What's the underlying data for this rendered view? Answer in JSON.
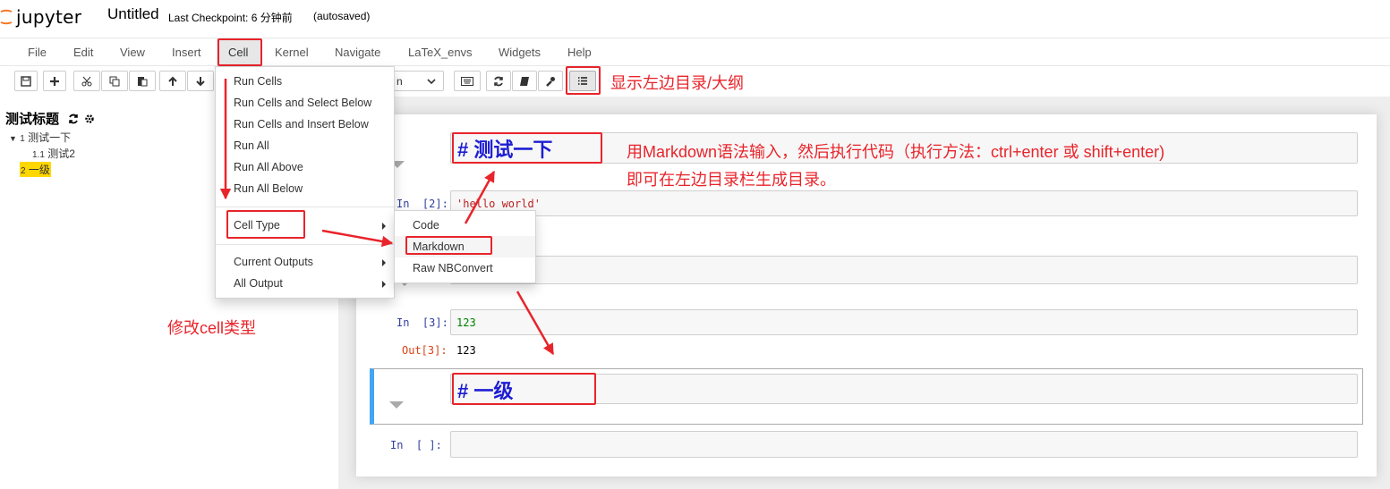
{
  "header": {
    "logo_text": "jupyter",
    "notebook_title": "Untitled",
    "checkpoint": "Last Checkpoint: 6 分钟前",
    "autosaved": "(autosaved)"
  },
  "menubar": [
    "File",
    "Edit",
    "View",
    "Insert",
    "Cell",
    "Kernel",
    "Navigate",
    "LaTeX_envs",
    "Widgets",
    "Help"
  ],
  "toolbar": {
    "celltype_partial": "n",
    "icons": [
      "save-icon",
      "plus-icon",
      "scissors-icon",
      "copy-icon",
      "paste-icon",
      "arrow-up-icon",
      "arrow-down-icon",
      "keyboard-icon",
      "refresh-icon",
      "book-icon",
      "wrench-icon",
      "list-icon"
    ]
  },
  "toc": {
    "title": "测试标题",
    "items": [
      {
        "num": "1",
        "label": "测试一下"
      },
      {
        "num": "1.1",
        "label": "测试2"
      },
      {
        "num": "2",
        "label": "一级"
      }
    ],
    "highlight_color": "#ffd700"
  },
  "cell_menu": {
    "items": [
      "Run Cells",
      "Run Cells and Select Below",
      "Run Cells and Insert Below",
      "Run All",
      "Run All Above",
      "Run All Below"
    ],
    "cell_type": "Cell Type",
    "current_outputs": "Current Outputs",
    "all_output": "All Output"
  },
  "cell_type_submenu": [
    "Code",
    "Markdown",
    "Raw NBConvert"
  ],
  "cells": {
    "md1": "# 测试一下",
    "c2_prompt": "In  [2]:",
    "c2_code": "'hello world'",
    "c3_prompt": "In  [3]:",
    "c3_code": "123",
    "c3_out_prompt": "Out[3]:",
    "c3_out": "123",
    "md2": "# 一级",
    "empty_prompt": "In  [ ]:"
  },
  "annotations": {
    "toc_note": "显示左边目录/大纲",
    "markdown_note_1": "用Markdown语法输入，然后执行代码（执行方法：ctrl+enter 或 shift+enter)",
    "markdown_note_2": "即可在左边目录栏生成目录。",
    "celltype_note": "修改cell类型"
  },
  "colors": {
    "annotation_red": "#e8242b",
    "markdown_blue": "#1d1dd3",
    "prompt_in": "#303f9f",
    "prompt_out": "#d84315",
    "selected_cell_bar": "#42a5f5"
  }
}
